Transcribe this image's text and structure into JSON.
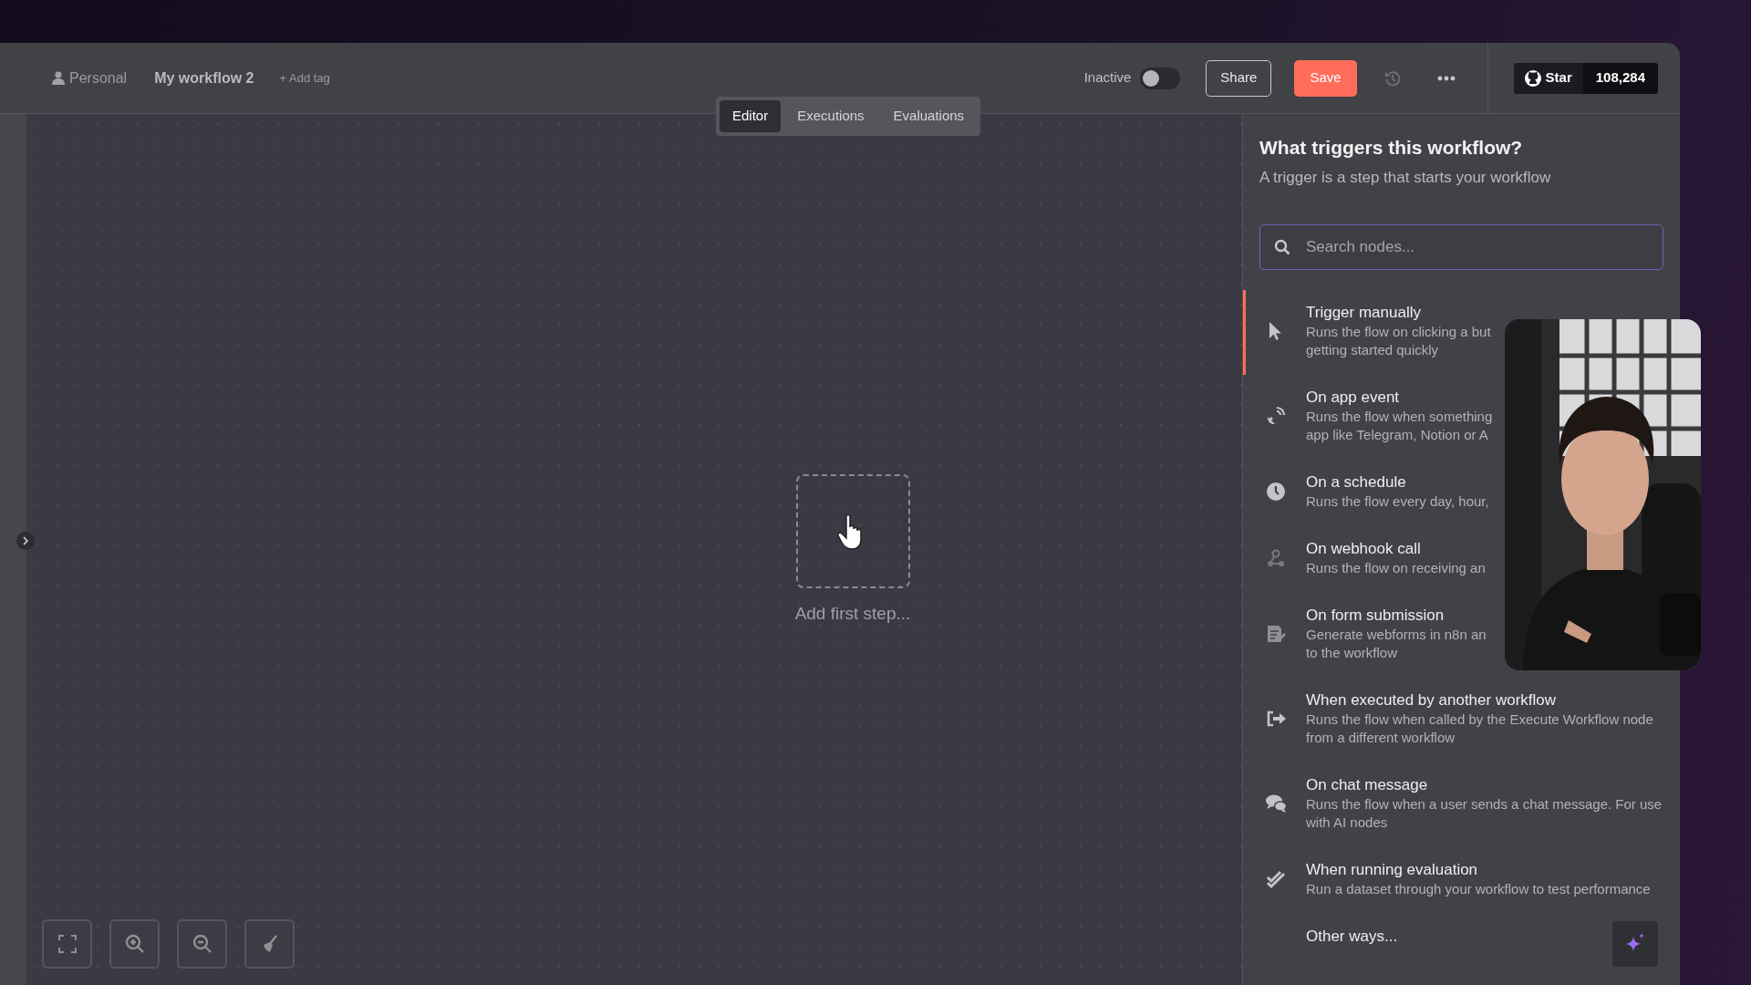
{
  "header": {
    "project": "Personal",
    "workflow_name": "My workflow 2",
    "add_tag": "+ Add tag",
    "status": {
      "label": "Inactive",
      "on": false
    },
    "buttons": [
      {
        "kind": "outline",
        "label": "Share"
      },
      {
        "kind": "primary",
        "label": "Save"
      }
    ],
    "github": {
      "label": "Star",
      "count": "108,284"
    }
  },
  "tabs": [
    {
      "label": "Editor",
      "selected": true
    },
    {
      "label": "Executions",
      "selected": false
    },
    {
      "label": "Evaluations",
      "selected": false
    }
  ],
  "canvas": {
    "add_step": "Add first step..."
  },
  "panel": {
    "title": "What triggers this workflow?",
    "subtitle": "A trigger is a step that starts your workflow",
    "search": {
      "placeholder": "Search nodes..."
    },
    "items": [
      {
        "title": "Trigger manually",
        "description": [
          "Runs the flow on clicking a but",
          "getting started quickly"
        ],
        "selected": true
      },
      {
        "title": "On app event",
        "description": [
          "Runs the flow when something",
          "app like Telegram, Notion or A"
        ],
        "selected": false
      },
      {
        "title": "On a schedule",
        "description": [
          "Runs the flow every day, hour,"
        ],
        "selected": false
      },
      {
        "title": "On webhook call",
        "description": [
          "Runs the flow on receiving an"
        ],
        "selected": false
      },
      {
        "title": "On form submission",
        "description": [
          "Generate webforms in n8n an",
          "to the workflow"
        ],
        "selected": false
      },
      {
        "title": "When executed by another workflow",
        "description": [
          "Runs the flow when called by the Execute Workflow node from a different workflow"
        ],
        "selected": false
      },
      {
        "title": "On chat message",
        "description": [
          "Runs the flow when a user sends a chat message. For use with AI nodes"
        ],
        "selected": false
      },
      {
        "title": "When running evaluation",
        "description": [
          "Run a dataset through your workflow to test performance"
        ],
        "selected": false
      },
      {
        "title": "Other ways...",
        "selected": false
      }
    ]
  }
}
